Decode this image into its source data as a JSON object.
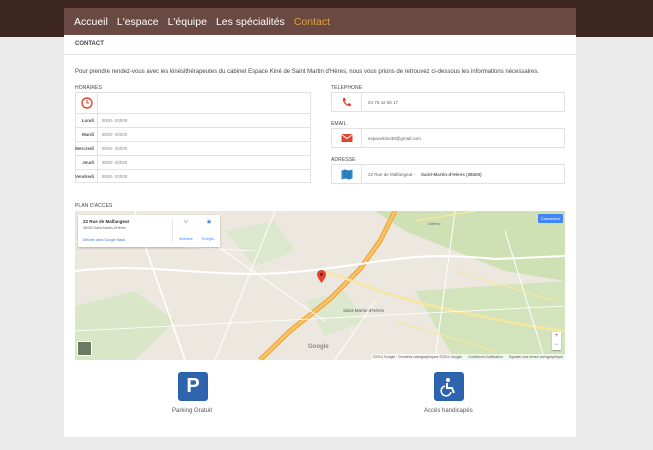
{
  "nav": {
    "items": [
      {
        "label": "Accueil",
        "active": false
      },
      {
        "label": "L'espace",
        "active": false
      },
      {
        "label": "L'équipe",
        "active": false
      },
      {
        "label": "Les spécialités",
        "active": false
      },
      {
        "label": "Contact",
        "active": true
      }
    ]
  },
  "page": {
    "breadcrumb": "CONTACT",
    "intro": "Pour prendre rendez-vous avec les kinésithérapeutes du cabinet Espace Kiné de Saint Martin d'Hères,  nous vous prions de retrouvez ci-dessous les informations nécessaires."
  },
  "hours": {
    "title": "HORAIRES",
    "rows": [
      {
        "day": "Lundi",
        "time": "8h00- 20h00"
      },
      {
        "day": "Mardi",
        "time": "8h00- 20h00"
      },
      {
        "day": "Mercredi",
        "time": "8h00- 20h00"
      },
      {
        "day": "Jeudi",
        "time": "8h00- 20h00"
      },
      {
        "day": "Vendredi",
        "time": "8h00- 20h00"
      }
    ]
  },
  "contact": {
    "phone_title": "TELEPHONE",
    "phone": "04 76 42 65 17",
    "email_title": "EMAIL",
    "email": "espacekine38@gmail.com",
    "address_title": "ADRESSE",
    "address_street": "22 Rue de Malfangeat -",
    "address_city": "Saint-Martin-d'Hères (38400)"
  },
  "map": {
    "title": "PLAN D'ACCES",
    "card_title": "22 Rue de Malfangeat",
    "card_subtitle": "38400 Saint-Martin-d'Hères",
    "card_link": "Afficher dans Google Maps",
    "directions": "Itinéraire",
    "save": "Enregis...",
    "login": "Connexion",
    "city_label": "Saint-Martin-d'Hères",
    "town_label": "Gières",
    "google": "Google",
    "footer_copyright": "©2014 Google · Données cartographiques ©2014 Google",
    "footer_terms": "Conditions d'utilisation",
    "footer_report": "Signaler une erreur cartographique"
  },
  "features": {
    "parking_icon": "P",
    "parking_label": "Parking Gratuit",
    "access_label": "Accès handicapés"
  },
  "colors": {
    "topbar": "#3d2520",
    "nav": "#6b4943",
    "nav_active": "#e0a03c",
    "icon_red": "#e0452f",
    "icon_blue": "#2f64ae"
  }
}
